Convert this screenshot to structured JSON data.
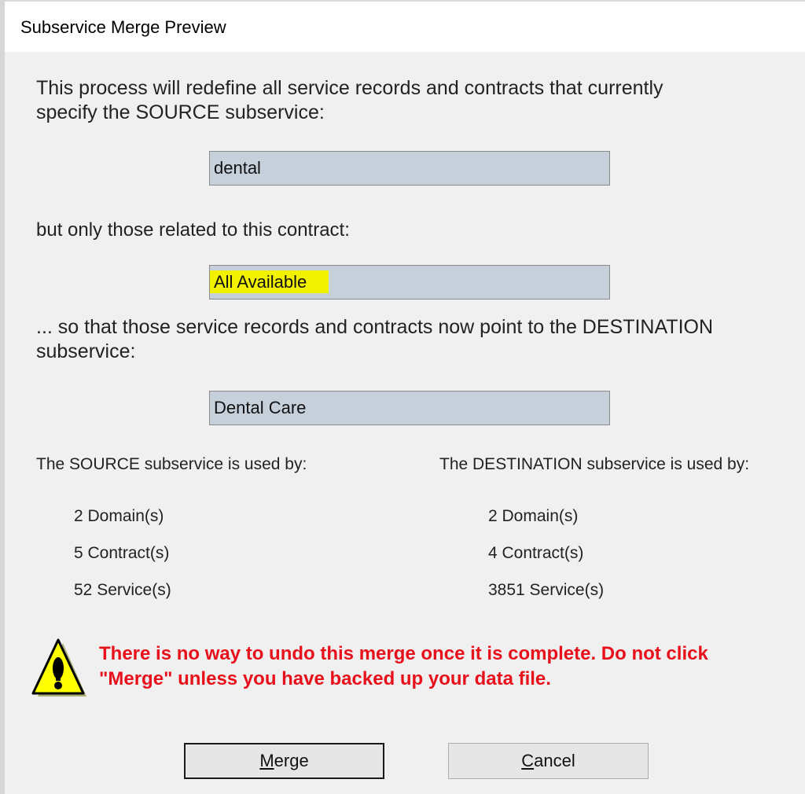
{
  "window": {
    "title": "Subservice Merge Preview"
  },
  "intro_line1": "This process will redefine all service records and contracts that currently",
  "intro_line2": "specify the SOURCE subservice:",
  "source_field": {
    "value": "dental"
  },
  "contract_label": "but only those related to this contract:",
  "contract_field": {
    "value": "All Available",
    "highlight_color": "#f2f200"
  },
  "destination_line1": "... so that those service records and contracts now point to the DESTINATION",
  "destination_line2": "subservice:",
  "destination_field": {
    "value": "Dental Care"
  },
  "source_usage": {
    "heading": "The SOURCE subservice is used by:",
    "items": [
      "2 Domain(s)",
      "5 Contract(s)",
      "52 Service(s)"
    ]
  },
  "destination_usage": {
    "heading": "The DESTINATION subservice is used by:",
    "items": [
      "2 Domain(s)",
      "4 Contract(s)",
      "3851 Service(s)"
    ]
  },
  "warning": {
    "icon": "warning-icon",
    "line1": "There is no way to undo this merge once it is complete. Do not click",
    "line2": "\"Merge\" unless you have backed up your data file.",
    "color": "#e8101b"
  },
  "buttons": {
    "merge_accel": "M",
    "merge_rest": "erge",
    "cancel_accel": "C",
    "cancel_rest": "ancel"
  }
}
